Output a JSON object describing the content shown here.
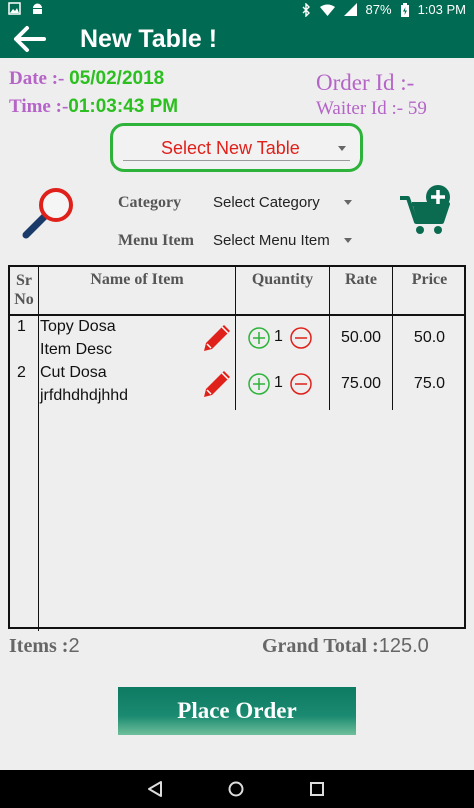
{
  "status_bar": {
    "battery": "87%",
    "time": "1:03 PM"
  },
  "app_bar": {
    "title": "New Table !"
  },
  "info": {
    "date_label": "Date :- ",
    "date_value": "05/02/2018",
    "time_label": "Time :-",
    "time_value": "01:03:43 PM",
    "order_id": "Order Id :-",
    "waiter_id": "Waiter Id :- 59"
  },
  "table_select": {
    "selected": "Select New Table"
  },
  "filters": {
    "category_label": "Category",
    "category_value": "Select Category",
    "menu_label": "Menu Item",
    "menu_value": "Select Menu Item"
  },
  "grid": {
    "headers": {
      "sr": "Sr",
      "no": "No",
      "name": "Name of Item",
      "quantity": "Quantity",
      "rate": "Rate",
      "price": "Price"
    },
    "rows": [
      {
        "sr": "1",
        "name": "Topy Dosa",
        "desc": "Item Desc",
        "qty": "1",
        "rate": "50.00",
        "price": "50.0"
      },
      {
        "sr": "2",
        "name": "Cut Dosa",
        "desc": "jrfdhdhdjhhd",
        "qty": "1",
        "rate": "75.00",
        "price": "75.0"
      }
    ]
  },
  "summary": {
    "items_label": "Items :",
    "items_value": "2",
    "total_label": "Grand Total :",
    "total_value": "125.0"
  },
  "actions": {
    "place_order": "Place Order"
  },
  "colors": {
    "primary": "#006b52",
    "accent_green": "#2bc01f",
    "purple": "#b564c7",
    "red": "#e0201a"
  }
}
